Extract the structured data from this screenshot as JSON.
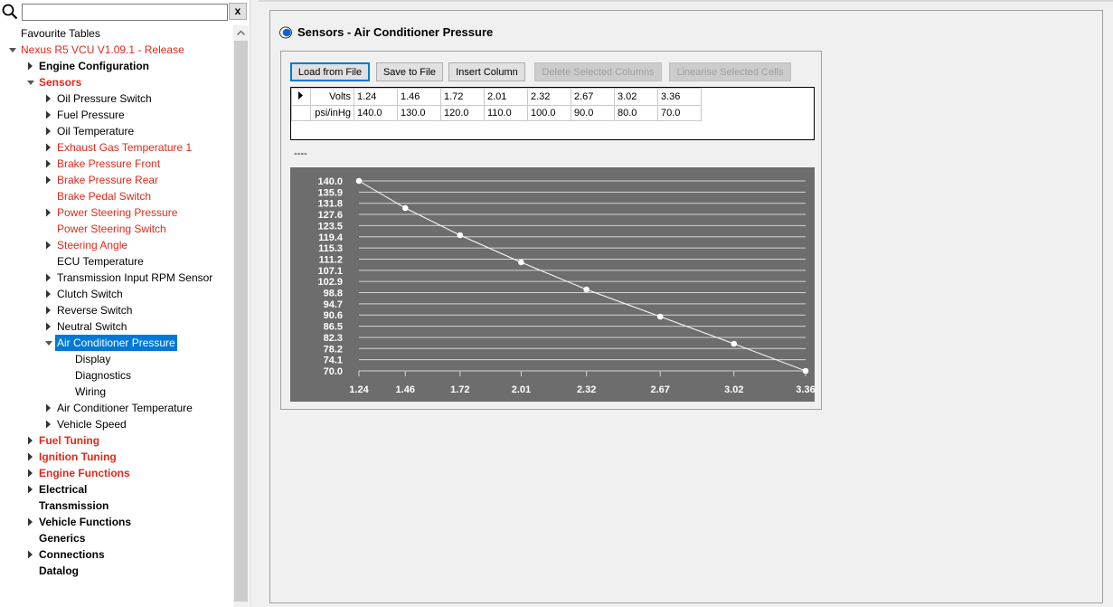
{
  "search": {
    "value": "",
    "clear_label": "x"
  },
  "tree": [
    {
      "label": "Favourite Tables",
      "level": 0,
      "expander": "none",
      "style": "normal"
    },
    {
      "label": "Nexus R5 VCU V1.09.1 - Release",
      "level": 0,
      "expander": "open",
      "style": "red"
    },
    {
      "label": "Engine Configuration",
      "level": 1,
      "expander": "closed",
      "style": "bold"
    },
    {
      "label": "Sensors",
      "level": 1,
      "expander": "open",
      "style": "bold-red"
    },
    {
      "label": "Oil Pressure Switch",
      "level": 2,
      "expander": "closed",
      "style": "normal"
    },
    {
      "label": "Fuel Pressure",
      "level": 2,
      "expander": "closed",
      "style": "normal"
    },
    {
      "label": "Oil Temperature",
      "level": 2,
      "expander": "closed",
      "style": "normal"
    },
    {
      "label": "Exhaust Gas Temperature 1",
      "level": 2,
      "expander": "closed",
      "style": "red"
    },
    {
      "label": "Brake Pressure Front",
      "level": 2,
      "expander": "closed",
      "style": "red"
    },
    {
      "label": "Brake Pressure Rear",
      "level": 2,
      "expander": "closed",
      "style": "red"
    },
    {
      "label": "Brake Pedal Switch",
      "level": 2,
      "expander": "none",
      "style": "red"
    },
    {
      "label": "Power Steering Pressure",
      "level": 2,
      "expander": "closed",
      "style": "red"
    },
    {
      "label": "Power Steering Switch",
      "level": 2,
      "expander": "none",
      "style": "red"
    },
    {
      "label": "Steering Angle",
      "level": 2,
      "expander": "closed",
      "style": "red"
    },
    {
      "label": "ECU Temperature",
      "level": 2,
      "expander": "none",
      "style": "normal"
    },
    {
      "label": "Transmission Input RPM Sensor",
      "level": 2,
      "expander": "closed",
      "style": "normal"
    },
    {
      "label": "Clutch Switch",
      "level": 2,
      "expander": "closed",
      "style": "normal"
    },
    {
      "label": "Reverse Switch",
      "level": 2,
      "expander": "closed",
      "style": "normal"
    },
    {
      "label": "Neutral Switch",
      "level": 2,
      "expander": "closed",
      "style": "normal"
    },
    {
      "label": "Air Conditioner Pressure",
      "level": 2,
      "expander": "open",
      "style": "selected"
    },
    {
      "label": "Display",
      "level": 3,
      "expander": "none",
      "style": "normal"
    },
    {
      "label": "Diagnostics",
      "level": 3,
      "expander": "none",
      "style": "normal"
    },
    {
      "label": "Wiring",
      "level": 3,
      "expander": "none",
      "style": "normal"
    },
    {
      "label": "Air Conditioner Temperature",
      "level": 2,
      "expander": "closed",
      "style": "normal"
    },
    {
      "label": "Vehicle Speed",
      "level": 2,
      "expander": "closed",
      "style": "normal"
    },
    {
      "label": "Fuel Tuning",
      "level": 1,
      "expander": "closed",
      "style": "bold-red"
    },
    {
      "label": "Ignition Tuning",
      "level": 1,
      "expander": "closed",
      "style": "bold-red"
    },
    {
      "label": "Engine Functions",
      "level": 1,
      "expander": "closed",
      "style": "bold-red"
    },
    {
      "label": "Electrical",
      "level": 1,
      "expander": "closed",
      "style": "bold"
    },
    {
      "label": "Transmission",
      "level": 1,
      "expander": "none",
      "style": "bold"
    },
    {
      "label": "Vehicle Functions",
      "level": 1,
      "expander": "closed",
      "style": "bold"
    },
    {
      "label": "Generics",
      "level": 1,
      "expander": "none",
      "style": "bold"
    },
    {
      "label": "Connections",
      "level": 1,
      "expander": "closed",
      "style": "bold"
    },
    {
      "label": "Datalog",
      "level": 1,
      "expander": "none",
      "style": "bold"
    }
  ],
  "panel": {
    "title": "Sensors - Air Conditioner Pressure",
    "buttons": {
      "load": "Load from File",
      "save": "Save to File",
      "insert": "Insert Column",
      "delete": "Delete Selected Columns",
      "linearise": "Linearise Selected Cells"
    },
    "table": {
      "row_labels": [
        "Volts",
        "psi/inHg"
      ],
      "volts": [
        "1.24",
        "1.46",
        "1.72",
        "2.01",
        "2.32",
        "2.67",
        "3.02",
        "3.36"
      ],
      "psi": [
        "140.0",
        "130.0",
        "120.0",
        "110.0",
        "100.0",
        "90.0",
        "80.0",
        "70.0"
      ]
    },
    "status_text": "----"
  },
  "colors": {
    "accent": "#0078d7",
    "red_text": "#e0291b",
    "chart_bg": "#6d6d6d"
  },
  "chart_data": {
    "type": "line",
    "title": "",
    "xlabel": "",
    "ylabel": "",
    "x": [
      1.24,
      1.46,
      1.72,
      2.01,
      2.32,
      2.67,
      3.02,
      3.36
    ],
    "series": [
      {
        "values": [
          140.0,
          130.0,
          120.0,
          110.0,
          100.0,
          90.0,
          80.0,
          70.0
        ]
      }
    ],
    "x_tick_labels": [
      "1.24",
      "1.46",
      "1.72",
      "2.01",
      "2.32",
      "2.67",
      "3.02",
      "3.36"
    ],
    "y_tick_labels": [
      "140.0",
      "135.9",
      "131.8",
      "127.6",
      "123.5",
      "119.4",
      "115.3",
      "111.2",
      "107.1",
      "102.9",
      "98.8",
      "94.7",
      "90.6",
      "86.5",
      "82.3",
      "78.2",
      "74.1",
      "70.0"
    ],
    "xlim": [
      1.24,
      3.36
    ],
    "ylim": [
      70.0,
      140.0
    ],
    "grid": true,
    "legend": "none"
  }
}
